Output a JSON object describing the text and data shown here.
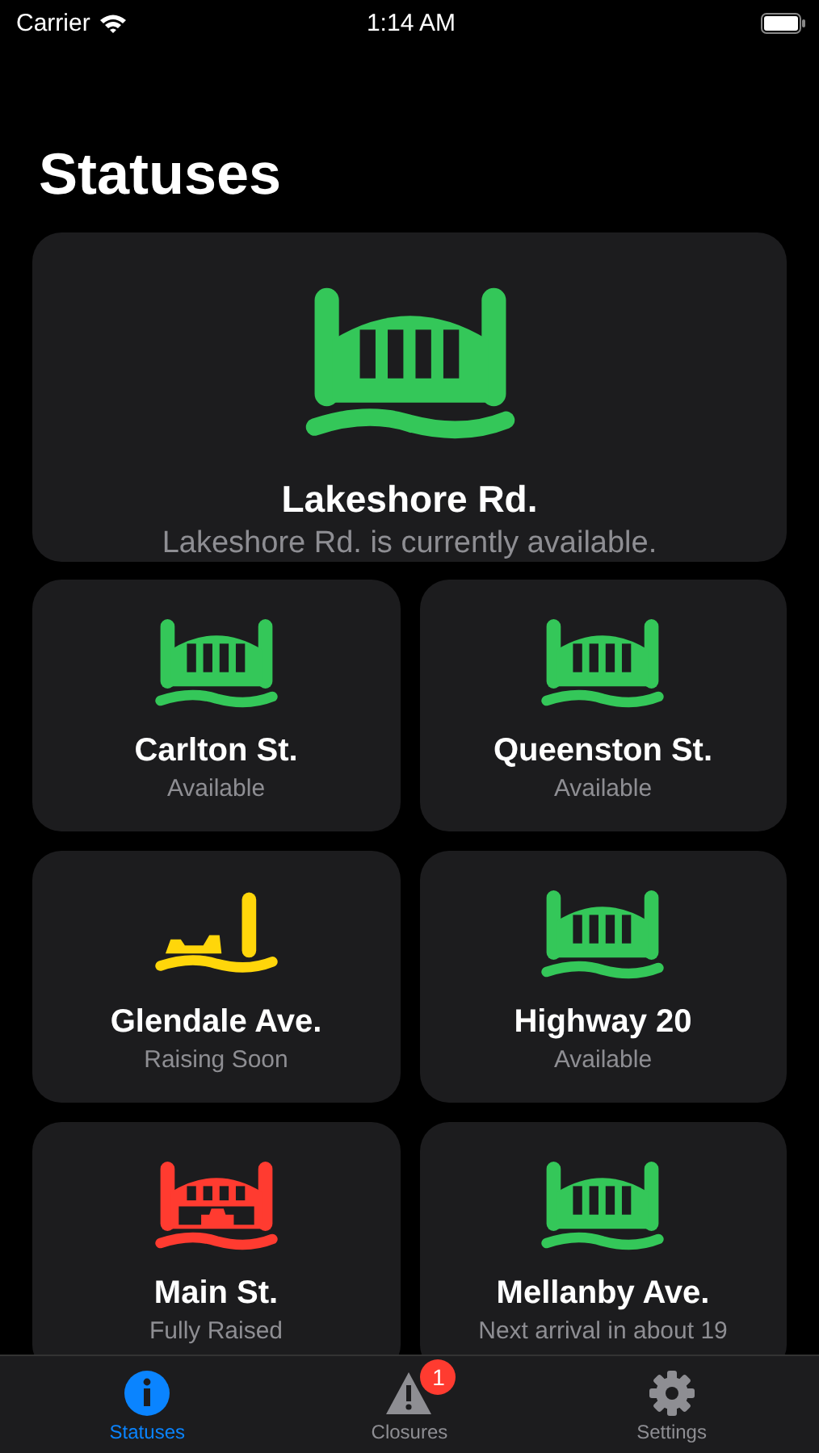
{
  "status_bar": {
    "carrier": "Carrier",
    "time": "1:14 AM"
  },
  "title": "Statuses",
  "featured": {
    "name": "Lakeshore Rd.",
    "kind": "available",
    "message": "Lakeshore Rd. is currently available."
  },
  "bridges": [
    {
      "name": "Carlton St.",
      "kind": "available",
      "message": "Available"
    },
    {
      "name": "Queenston St.",
      "kind": "available",
      "message": "Available"
    },
    {
      "name": "Glendale Ave.",
      "kind": "raising",
      "message": "Raising Soon"
    },
    {
      "name": "Highway 20",
      "kind": "available",
      "message": "Available"
    },
    {
      "name": "Main St.",
      "kind": "raised",
      "message": "Fully Raised"
    },
    {
      "name": "Mellanby Ave.",
      "kind": "available",
      "message": "Next arrival in about 19"
    }
  ],
  "tabs": [
    {
      "label": "Statuses",
      "kind": "info",
      "selected": true
    },
    {
      "label": "Closures",
      "kind": "warning",
      "selected": false,
      "badge": "1"
    },
    {
      "label": "Settings",
      "kind": "gear",
      "selected": false
    }
  ]
}
